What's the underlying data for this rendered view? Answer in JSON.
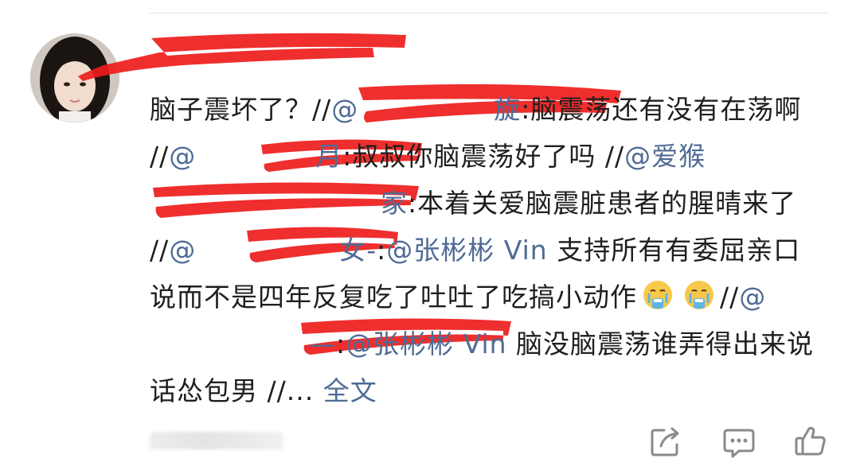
{
  "comment": {
    "segments": [
      {
        "text": "脑子震坏了？//",
        "type": "text"
      },
      {
        "text": "@",
        "type": "mention"
      },
      {
        "text": "旋",
        "type": "mention"
      },
      {
        "text": ":脑震荡还有没有在荡啊 //",
        "type": "text"
      },
      {
        "text": "@",
        "type": "mention"
      },
      {
        "text": "月",
        "type": "mention"
      },
      {
        "text": ":叔叔你脑震荡好了吗 //",
        "type": "text"
      },
      {
        "text": "@爱",
        "type": "mention"
      },
      {
        "text": "猴",
        "type": "mention"
      },
      {
        "text": "家",
        "type": "mention"
      },
      {
        "text": ":本着关爱脑震脏患者的腥晴来了 //",
        "type": "text"
      },
      {
        "text": "@",
        "type": "mention"
      },
      {
        "text": "女-",
        "type": "mention"
      },
      {
        "text": ":",
        "type": "text"
      },
      {
        "text": "@张彬彬 Vin",
        "type": "mention"
      },
      {
        "text": " 支持所有有委屈亲口说而不是四年反复吃了吐吐了吃搞小动作",
        "type": "text"
      },
      {
        "text": "//",
        "type": "text"
      },
      {
        "text": "@",
        "type": "mention"
      },
      {
        "text": "—",
        "type": "mention"
      },
      {
        "text": ":",
        "type": "text"
      },
      {
        "text": "@张彬彬 Vin",
        "type": "mention"
      },
      {
        "text": " 脑没脑震荡谁弄得出来说话怂包男 //...",
        "type": "text"
      },
      {
        "text": " 全文",
        "type": "link"
      }
    ]
  },
  "actions": {
    "repost_icon": "share-arrow-icon",
    "comment_icon": "comment-bubble-icon",
    "like_icon": "thumbs-up-icon"
  },
  "colors": {
    "text": "#1f1f1f",
    "link": "#4f6b95",
    "redaction": "#ee1c1c"
  }
}
